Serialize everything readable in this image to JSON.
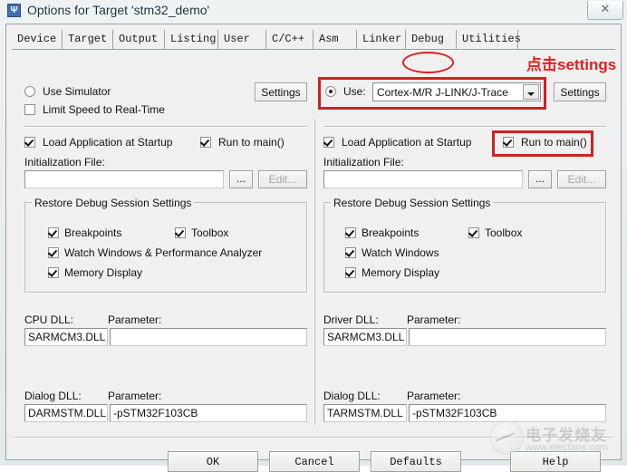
{
  "window": {
    "title": "Options for Target 'stm32_demo'",
    "icon": "app-icon",
    "close_label": "✕"
  },
  "tabs": [
    {
      "label": "Device"
    },
    {
      "label": "Target"
    },
    {
      "label": "Output"
    },
    {
      "label": "Listing"
    },
    {
      "label": "User"
    },
    {
      "label": "C/C++"
    },
    {
      "label": "Asm"
    },
    {
      "label": "Linker"
    },
    {
      "label": "Debug"
    },
    {
      "label": "Utilities"
    }
  ],
  "annotation": {
    "text": "点击settings",
    "color": "#e02020",
    "highlight_color": "#cf2222"
  },
  "left_pane": {
    "simulator_radio": {
      "label": "Use Simulator",
      "checked": false
    },
    "limit_speed": {
      "label": "Limit Speed to Real-Time",
      "checked": false
    },
    "settings_button": "Settings",
    "load_app": {
      "label": "Load Application at Startup",
      "checked": true
    },
    "run_to_main": {
      "label": "Run to main()",
      "checked": true
    },
    "init_file_label": "Initialization File:",
    "init_file_value": "",
    "browse_button": "...",
    "edit_button": "Edit...",
    "restore_group": {
      "title": "Restore Debug Session Settings",
      "items": [
        {
          "label": "Breakpoints",
          "checked": true
        },
        {
          "label": "Toolbox",
          "checked": true
        },
        {
          "label": "Watch Windows & Performance Analyzer",
          "checked": true
        },
        {
          "label": "Memory Display",
          "checked": true
        }
      ]
    },
    "cpu_dll_label": "CPU DLL:",
    "cpu_dll_value": "SARMCM3.DLL",
    "cpu_param_label": "Parameter:",
    "cpu_param_value": "",
    "dialog_dll_label": "Dialog DLL:",
    "dialog_dll_value": "DARMSTM.DLL",
    "dialog_param_label": "Parameter:",
    "dialog_param_value": "-pSTM32F103CB"
  },
  "right_pane": {
    "use_radio": {
      "label": "Use:",
      "checked": true
    },
    "driver_combo_value": "Cortex-M/R J-LINK/J-Trace",
    "settings_button": "Settings",
    "load_app": {
      "label": "Load Application at Startup",
      "checked": true
    },
    "run_to_main": {
      "label": "Run to main()",
      "checked": true
    },
    "init_file_label": "Initialization File:",
    "init_file_value": "",
    "browse_button": "...",
    "edit_button": "Edit...",
    "restore_group": {
      "title": "Restore Debug Session Settings",
      "items": [
        {
          "label": "Breakpoints",
          "checked": true
        },
        {
          "label": "Toolbox",
          "checked": true
        },
        {
          "label": "Watch Windows",
          "checked": true
        },
        {
          "label": "Memory Display",
          "checked": true
        }
      ]
    },
    "driver_dll_label": "Driver DLL:",
    "driver_dll_value": "SARMCM3.DLL",
    "driver_param_label": "Parameter:",
    "driver_param_value": "",
    "dialog_dll_label": "Dialog DLL:",
    "dialog_dll_value": "TARMSTM.DLL",
    "dialog_param_label": "Parameter:",
    "dialog_param_value": "-pSTM32F103CB"
  },
  "footer": {
    "ok": "OK",
    "cancel": "Cancel",
    "defaults": "Defaults",
    "help": "Help"
  },
  "watermark": {
    "cn": "电子发烧友",
    "url": "www.elecfans.com"
  }
}
